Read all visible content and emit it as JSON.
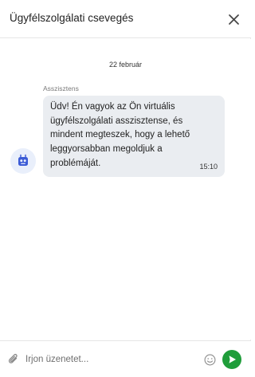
{
  "header": {
    "title": "Ügyfélszolgálati csevegés",
    "close_icon": "close-icon"
  },
  "conversation": {
    "date_separator": "22 február",
    "messages": [
      {
        "sender": "Asszisztens",
        "avatar_icon": "robot-icon",
        "text": "Üdv! Én vagyok az Ön virtuális ügyfélszolgálati asszisztense, és mindent megteszek, hogy a lehető leggyorsabban megoldjuk a problémáját.",
        "time": "15:10"
      }
    ]
  },
  "composer": {
    "placeholder": "Írjon üzenetet...",
    "value": "",
    "attach_icon": "paperclip-icon",
    "emoji_icon": "smiley-icon",
    "send_icon": "send-icon"
  },
  "colors": {
    "send_button": "#1f9d3a",
    "bubble_background": "#eaedf1",
    "avatar_background": "#e9effb",
    "avatar_icon": "#3b5bd6"
  }
}
